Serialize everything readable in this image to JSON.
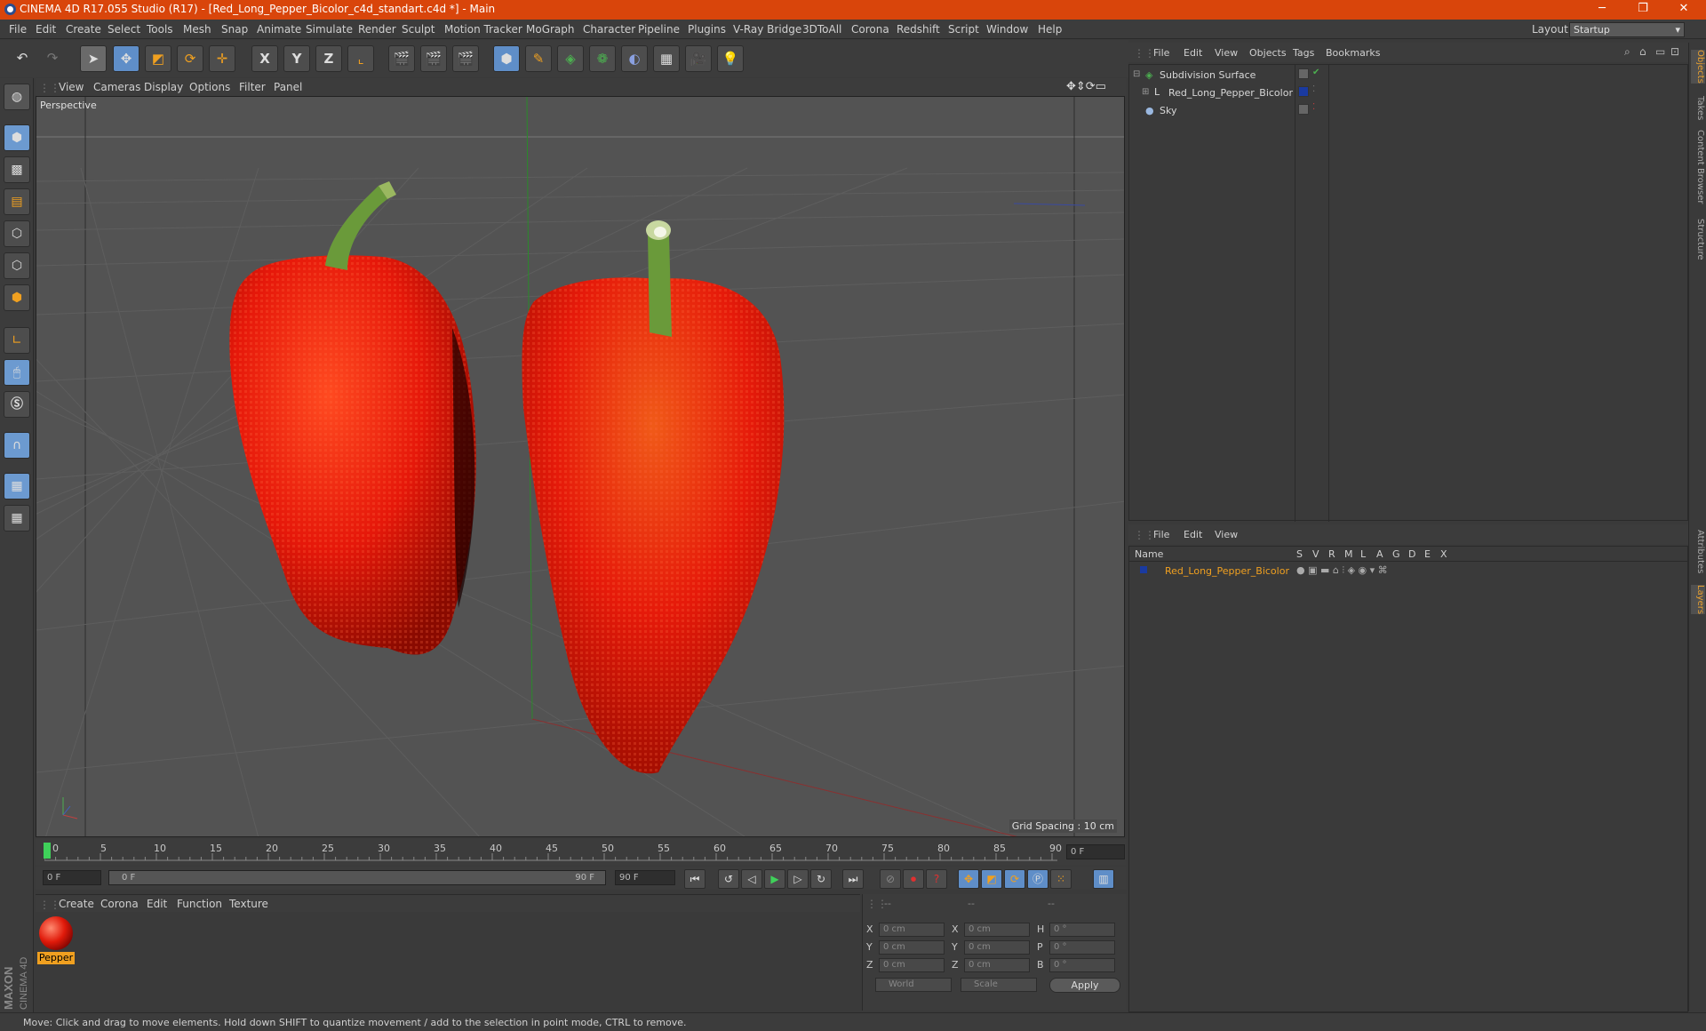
{
  "window": {
    "title": "CINEMA 4D R17.055 Studio (R17) - [Red_Long_Pepper_Bicolor_c4d_standart.c4d *] - Main",
    "minimize": "─",
    "maximize": "❐",
    "close": "✕"
  },
  "menubar": {
    "items": [
      "File",
      "Edit",
      "Create",
      "Select",
      "Tools",
      "Mesh",
      "Snap",
      "Animate",
      "Simulate",
      "Render",
      "Sculpt",
      "Motion Tracker",
      "MoGraph",
      "Character",
      "Pipeline",
      "Plugins",
      "V-Ray Bridge",
      "3DToAll",
      "Corona",
      "Redshift",
      "Script",
      "Window",
      "Help"
    ],
    "layout_label": "Layout:",
    "layout_value": "Startup"
  },
  "toolbar": {
    "axis_x": "X",
    "axis_y": "Y",
    "axis_z": "Z"
  },
  "viewport": {
    "menu": [
      "View",
      "Cameras",
      "Display",
      "Options",
      "Filter",
      "Panel"
    ],
    "label": "Perspective",
    "grid_spacing": "Grid Spacing : 10 cm",
    "colors": {
      "pepper": "#e0180a",
      "stem": "#6a9a3a",
      "background": "#535353"
    }
  },
  "timeline": {
    "ticks": [
      "0",
      "5",
      "10",
      "15",
      "20",
      "25",
      "30",
      "35",
      "40",
      "45",
      "50",
      "55",
      "60",
      "65",
      "70",
      "75",
      "80",
      "85",
      "90"
    ],
    "current_frame": "0 F",
    "start_field": "0 F",
    "range_start": "0 F",
    "range_end": "90 F",
    "end_field": "90 F"
  },
  "materials": {
    "menu": [
      "Create",
      "Corona",
      "Edit",
      "Function",
      "Texture"
    ],
    "items": [
      {
        "name": "Pepper"
      }
    ]
  },
  "coordinates": {
    "header": [
      "--",
      "--",
      "--"
    ],
    "rows": [
      {
        "a": "X",
        "av": "0 cm",
        "b": "X",
        "bv": "0 cm",
        "c": "H",
        "cv": "0 °"
      },
      {
        "a": "Y",
        "av": "0 cm",
        "b": "Y",
        "bv": "0 cm",
        "c": "P",
        "cv": "0 °"
      },
      {
        "a": "Z",
        "av": "0 cm",
        "b": "Z",
        "bv": "0 cm",
        "c": "B",
        "cv": "0 °"
      }
    ],
    "world": "World",
    "scale": "Scale",
    "apply": "Apply"
  },
  "objects": {
    "menu": [
      "File",
      "Edit",
      "View",
      "Objects",
      "Tags",
      "Bookmarks"
    ],
    "items": [
      {
        "name": "Subdivision Surface"
      },
      {
        "name": "Red_Long_Pepper_Bicolor"
      },
      {
        "name": "Sky"
      }
    ]
  },
  "layers": {
    "menu": [
      "File",
      "Edit",
      "View"
    ],
    "header_name": "Name",
    "columns": [
      "S",
      "V",
      "R",
      "M",
      "L",
      "A",
      "G",
      "D",
      "E",
      "X"
    ],
    "items": [
      {
        "name": "Red_Long_Pepper_Bicolor"
      }
    ]
  },
  "side_tabs": [
    "Objects",
    "Takes",
    "Content Browser",
    "Structure",
    "Attributes",
    "Layers"
  ],
  "logo": {
    "line1": "MAXON",
    "line2": "CINEMA 4D"
  },
  "status": "Move: Click and drag to move elements. Hold down SHIFT to quantize movement / add to the selection in point mode, CTRL to remove."
}
